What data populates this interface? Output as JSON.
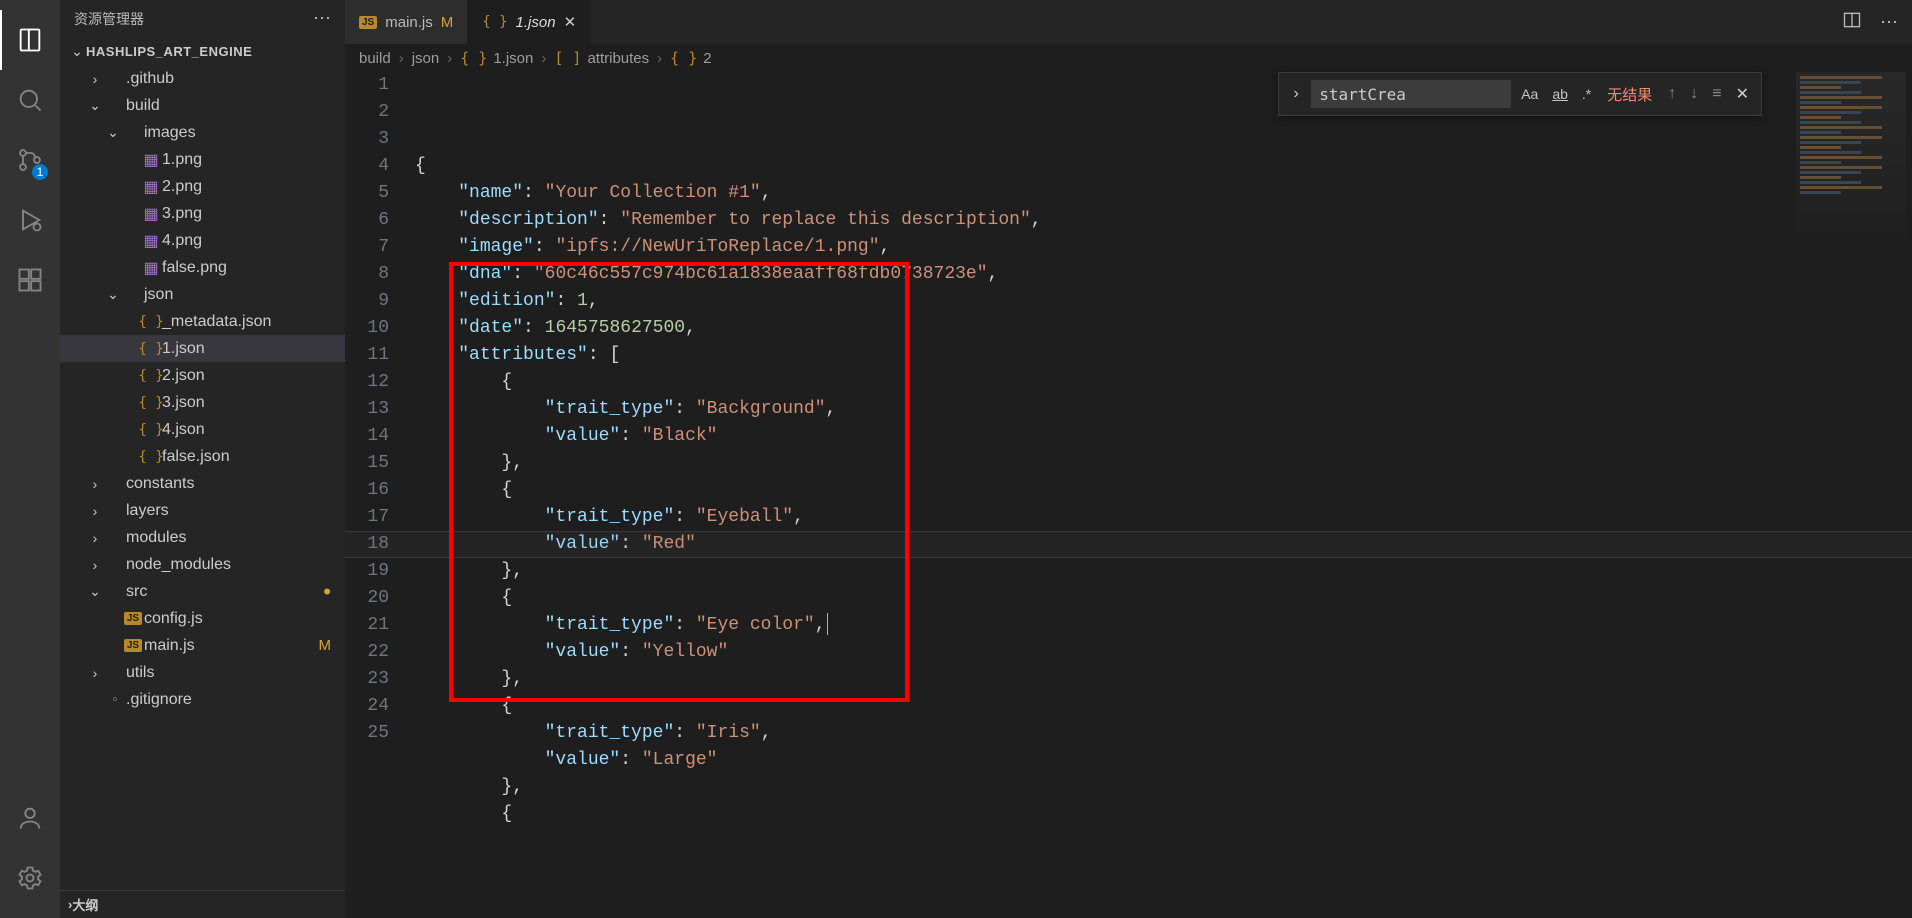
{
  "sidebar": {
    "title": "资源管理器",
    "root": "HASHLIPS_ART_ENGINE",
    "tree": [
      {
        "label": ".github",
        "type": "folder",
        "open": false,
        "depth": 1
      },
      {
        "label": "build",
        "type": "folder",
        "open": true,
        "depth": 1
      },
      {
        "label": "images",
        "type": "folder",
        "open": true,
        "depth": 2
      },
      {
        "label": "1.png",
        "type": "image",
        "depth": 3
      },
      {
        "label": "2.png",
        "type": "image",
        "depth": 3
      },
      {
        "label": "3.png",
        "type": "image",
        "depth": 3
      },
      {
        "label": "4.png",
        "type": "image",
        "depth": 3
      },
      {
        "label": "false.png",
        "type": "image",
        "depth": 3
      },
      {
        "label": "json",
        "type": "folder",
        "open": true,
        "depth": 2
      },
      {
        "label": "_metadata.json",
        "type": "json",
        "depth": 3
      },
      {
        "label": "1.json",
        "type": "json",
        "depth": 3,
        "selected": true
      },
      {
        "label": "2.json",
        "type": "json",
        "depth": 3
      },
      {
        "label": "3.json",
        "type": "json",
        "depth": 3
      },
      {
        "label": "4.json",
        "type": "json",
        "depth": 3
      },
      {
        "label": "false.json",
        "type": "json",
        "depth": 3
      },
      {
        "label": "constants",
        "type": "folder",
        "open": false,
        "depth": 1
      },
      {
        "label": "layers",
        "type": "folder",
        "open": false,
        "depth": 1
      },
      {
        "label": "modules",
        "type": "folder",
        "open": false,
        "depth": 1
      },
      {
        "label": "node_modules",
        "type": "folder",
        "open": false,
        "depth": 1
      },
      {
        "label": "src",
        "type": "folder",
        "open": true,
        "depth": 1,
        "modified": true
      },
      {
        "label": "config.js",
        "type": "js",
        "depth": 2
      },
      {
        "label": "main.js",
        "type": "js",
        "depth": 2,
        "mod_letter": "M"
      },
      {
        "label": "utils",
        "type": "folder",
        "open": false,
        "depth": 1
      },
      {
        "label": ".gitignore",
        "type": "file",
        "depth": 1
      }
    ],
    "outline": "大纲"
  },
  "activity": {
    "source_control_badge": "1"
  },
  "tabs": [
    {
      "name": "main.js",
      "mod": "M",
      "type": "js",
      "active": false
    },
    {
      "name": "1.json",
      "type": "json",
      "active": true,
      "italic": true
    }
  ],
  "breadcrumbs": [
    "build",
    "json",
    "1.json",
    "attributes",
    "2"
  ],
  "breadcrumb_symbols": [
    "",
    "",
    "{ }",
    "[ ]",
    "{ }"
  ],
  "find": {
    "value": "startCrea",
    "opts": [
      "Aa",
      "ab",
      ".*"
    ],
    "result": "无结果"
  },
  "file_content": {
    "name": "Your Collection #1",
    "description": "Remember to replace this description",
    "image": "ipfs://NewUriToReplace/1.png",
    "dna": "60c46c557c974bc61a1838eaaff68fdb0738723e",
    "edition": 1,
    "date": 1645758627500,
    "attributes": [
      {
        "trait_type": "Background",
        "value": "Black"
      },
      {
        "trait_type": "Eyeball",
        "value": "Red"
      },
      {
        "trait_type": "Eye color",
        "value": "Yellow"
      },
      {
        "trait_type": "Iris",
        "value": "Large"
      }
    ]
  },
  "line_numbers": [
    1,
    2,
    3,
    4,
    5,
    6,
    7,
    8,
    9,
    10,
    11,
    12,
    13,
    14,
    15,
    16,
    17,
    18,
    19,
    20,
    21,
    22,
    23,
    24,
    25
  ]
}
